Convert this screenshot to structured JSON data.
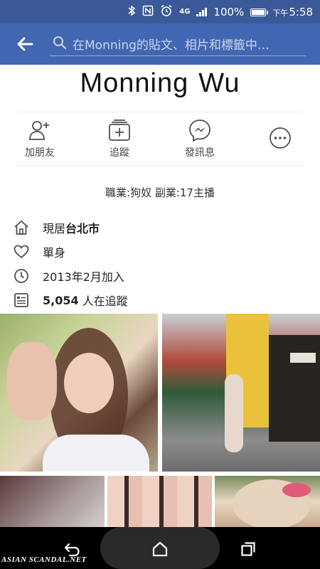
{
  "status_bar": {
    "network": "4G",
    "battery_percent": "100%",
    "time_period": "下午",
    "time": "5:58",
    "icons": [
      "bluetooth-icon",
      "nfc-icon",
      "alarm-icon",
      "signal-icon",
      "battery-icon"
    ]
  },
  "search": {
    "placeholder": "在Monning的貼文、相片和標籤中…"
  },
  "profile": {
    "first_name": "Monning",
    "last_name": "Wu",
    "bio": "職業:狗奴 副業:17主播"
  },
  "actions": [
    {
      "label": "加朋友",
      "icon": "add-friend-icon"
    },
    {
      "label": "追蹤",
      "icon": "follow-icon"
    },
    {
      "label": "發訊息",
      "icon": "messenger-icon"
    },
    {
      "label": "",
      "icon": "more-icon"
    }
  ],
  "info": {
    "lives_prefix": "現居",
    "lives_city": "台北市",
    "relationship": "單身",
    "joined": "2013年2月加入",
    "followers_count": "5,054",
    "followers_suffix": " 人在追蹤"
  },
  "watermark": "ASIAN SCANDAL.NET",
  "colors": {
    "facebook_blue": "#4267b2",
    "status_blue": "#3b5998"
  }
}
